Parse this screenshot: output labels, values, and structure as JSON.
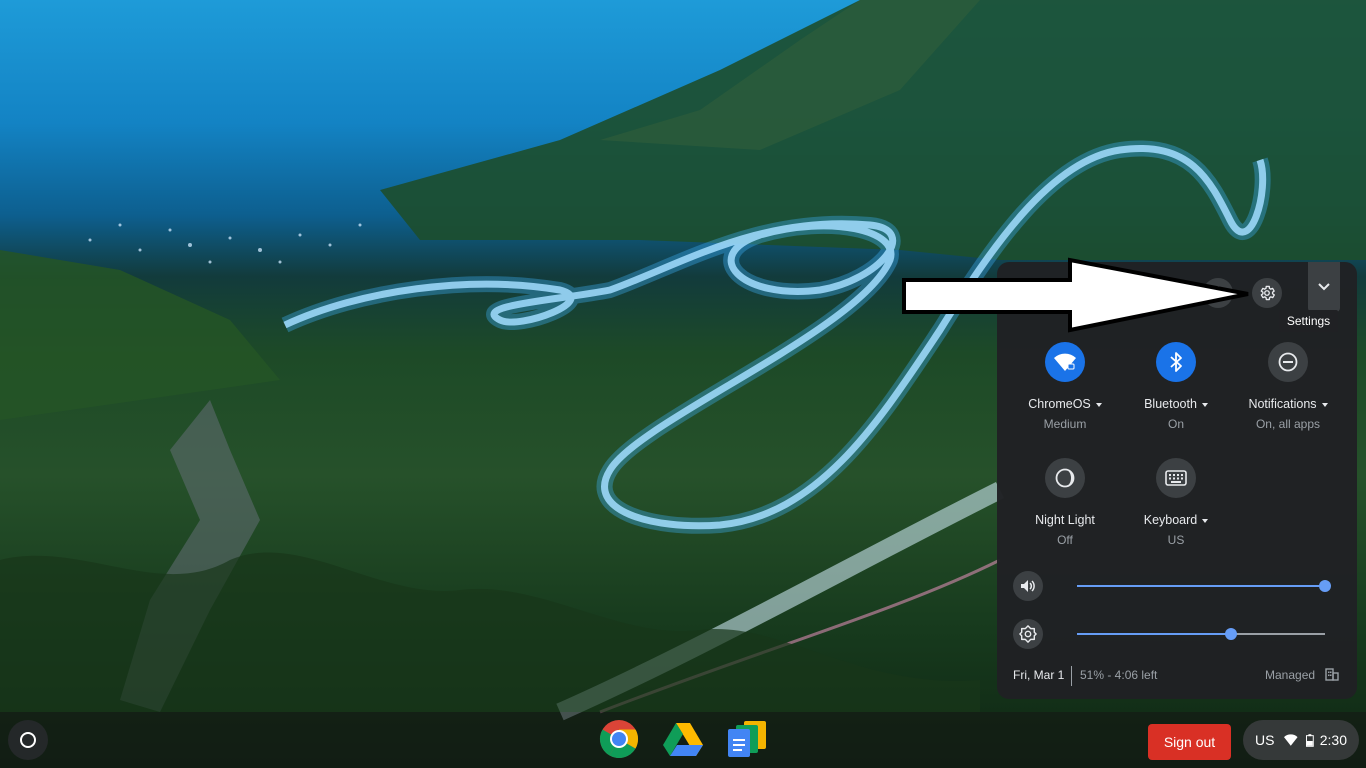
{
  "shelf": {
    "apps": [
      {
        "name": "Chrome",
        "icon": "chrome-icon"
      },
      {
        "name": "Google Drive",
        "icon": "drive-icon"
      },
      {
        "name": "Google Docs",
        "icon": "docs-icon"
      }
    ],
    "sign_out_label": "Sign out",
    "status": {
      "language": "US",
      "time": "2:30"
    }
  },
  "tray": {
    "tooltip": "Settings",
    "features": [
      {
        "label": "ChromeOS",
        "sub": "Medium",
        "icon": "wifi-icon",
        "state": "on",
        "dropdown": true
      },
      {
        "label": "Bluetooth",
        "sub": "On",
        "icon": "bluetooth-icon",
        "state": "on",
        "dropdown": true
      },
      {
        "label": "Notifications",
        "sub": "On, all apps",
        "icon": "do-not-disturb-icon",
        "state": "off",
        "dropdown": true
      },
      {
        "label": "Night Light",
        "sub": "Off",
        "icon": "night-light-icon",
        "state": "off",
        "dropdown": false
      },
      {
        "label": "Keyboard",
        "sub": "US",
        "icon": "keyboard-icon",
        "state": "off",
        "dropdown": true
      }
    ],
    "volume": {
      "level": 1.0,
      "icon": "volume-icon"
    },
    "brightness": {
      "level": 0.62,
      "icon": "brightness-icon"
    },
    "footer": {
      "date": "Fri, Mar 1",
      "battery": "51% - 4:06 left",
      "managed": "Managed"
    }
  },
  "colors": {
    "accent": "#1a73e8",
    "slider": "#669df6",
    "sign_out": "#d93025",
    "tray_bg": "#202124"
  }
}
